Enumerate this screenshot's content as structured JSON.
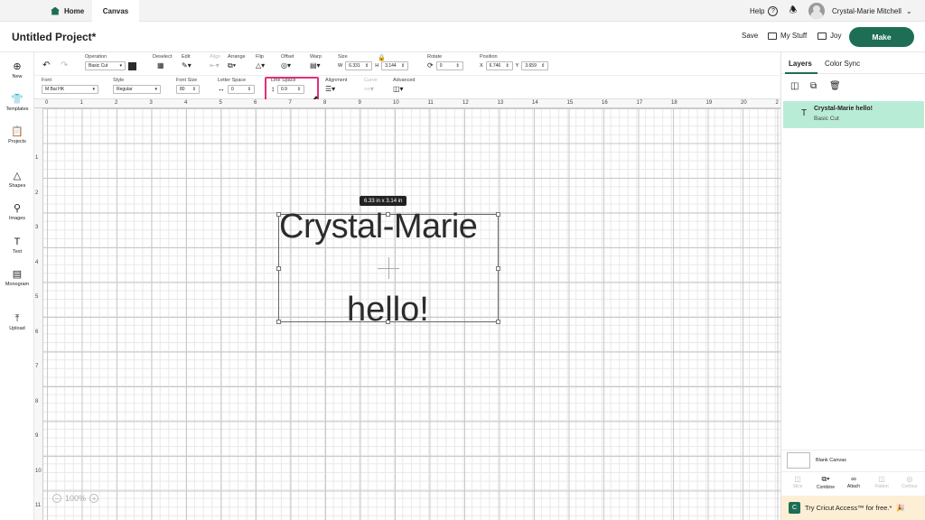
{
  "tabs": {
    "home": "Home",
    "canvas": "Canvas"
  },
  "header_right": {
    "help": "Help",
    "user_name": "Crystal-Marie Mitchell"
  },
  "project": {
    "title": "Untitled Project*",
    "save": "Save",
    "my_stuff": "My Stuff",
    "joy": "Joy",
    "make": "Make"
  },
  "sidebar": {
    "items": [
      "New",
      "Templates",
      "Projects",
      "Shapes",
      "Images",
      "Text",
      "Monogram",
      "Upload"
    ]
  },
  "toolbar1": {
    "operation_label": "Operation",
    "operation_value": "Basic Cut",
    "deselect": "Deselect",
    "edit": "Edit",
    "align": "Align",
    "arrange": "Arrange",
    "flip": "Flip",
    "offset": "Offset",
    "warp": "Warp",
    "size": "Size",
    "w_label": "W",
    "w_value": "6.331",
    "h_label": "H",
    "h_value": "3.144",
    "rotate": "Rotate",
    "rotate_value": "0",
    "position": "Position",
    "x_label": "X",
    "x_value": "6.746",
    "y_label": "Y",
    "y_value": "3.659"
  },
  "toolbar2": {
    "font_label": "Font",
    "font_value": "M Bai HK",
    "style_label": "Style",
    "style_value": "Regular",
    "font_size_label": "Font Size",
    "font_size_value": "80",
    "letter_space_label": "Letter Space",
    "letter_space_value": "0",
    "line_space_label": "Line Space",
    "line_space_value": "0.9",
    "alignment_label": "Alignment",
    "curve_label": "Curve",
    "advanced_label": "Advanced"
  },
  "ruler": {
    "top": [
      "0",
      "1",
      "2",
      "3",
      "4",
      "5",
      "6",
      "7",
      "8",
      "9",
      "10",
      "11",
      "12",
      "13",
      "14",
      "15",
      "16",
      "17",
      "18",
      "19",
      "20",
      "2"
    ],
    "left": [
      "1",
      "2",
      "3",
      "4",
      "5",
      "6",
      "7",
      "8",
      "9",
      "10",
      "11"
    ]
  },
  "canvas": {
    "line1": "Crystal-Marie",
    "line2": "hello!",
    "dimensions": "6.33 in x 3.14 in",
    "zoom": "100%"
  },
  "panel": {
    "tab_layers": "Layers",
    "tab_color_sync": "Color Sync",
    "layer_name": "Crystal-Marie hello!",
    "layer_op": "Basic Cut",
    "blank_canvas": "Blank Canvas",
    "actions": [
      "Slice",
      "Combine",
      "Attach",
      "Flatten",
      "Contour"
    ],
    "promo": "Try Cricut Access™ for free.*"
  },
  "colors": {
    "accent": "#1d6e55",
    "highlight": "#e1307a",
    "layer_selected": "#b9ecd7"
  }
}
